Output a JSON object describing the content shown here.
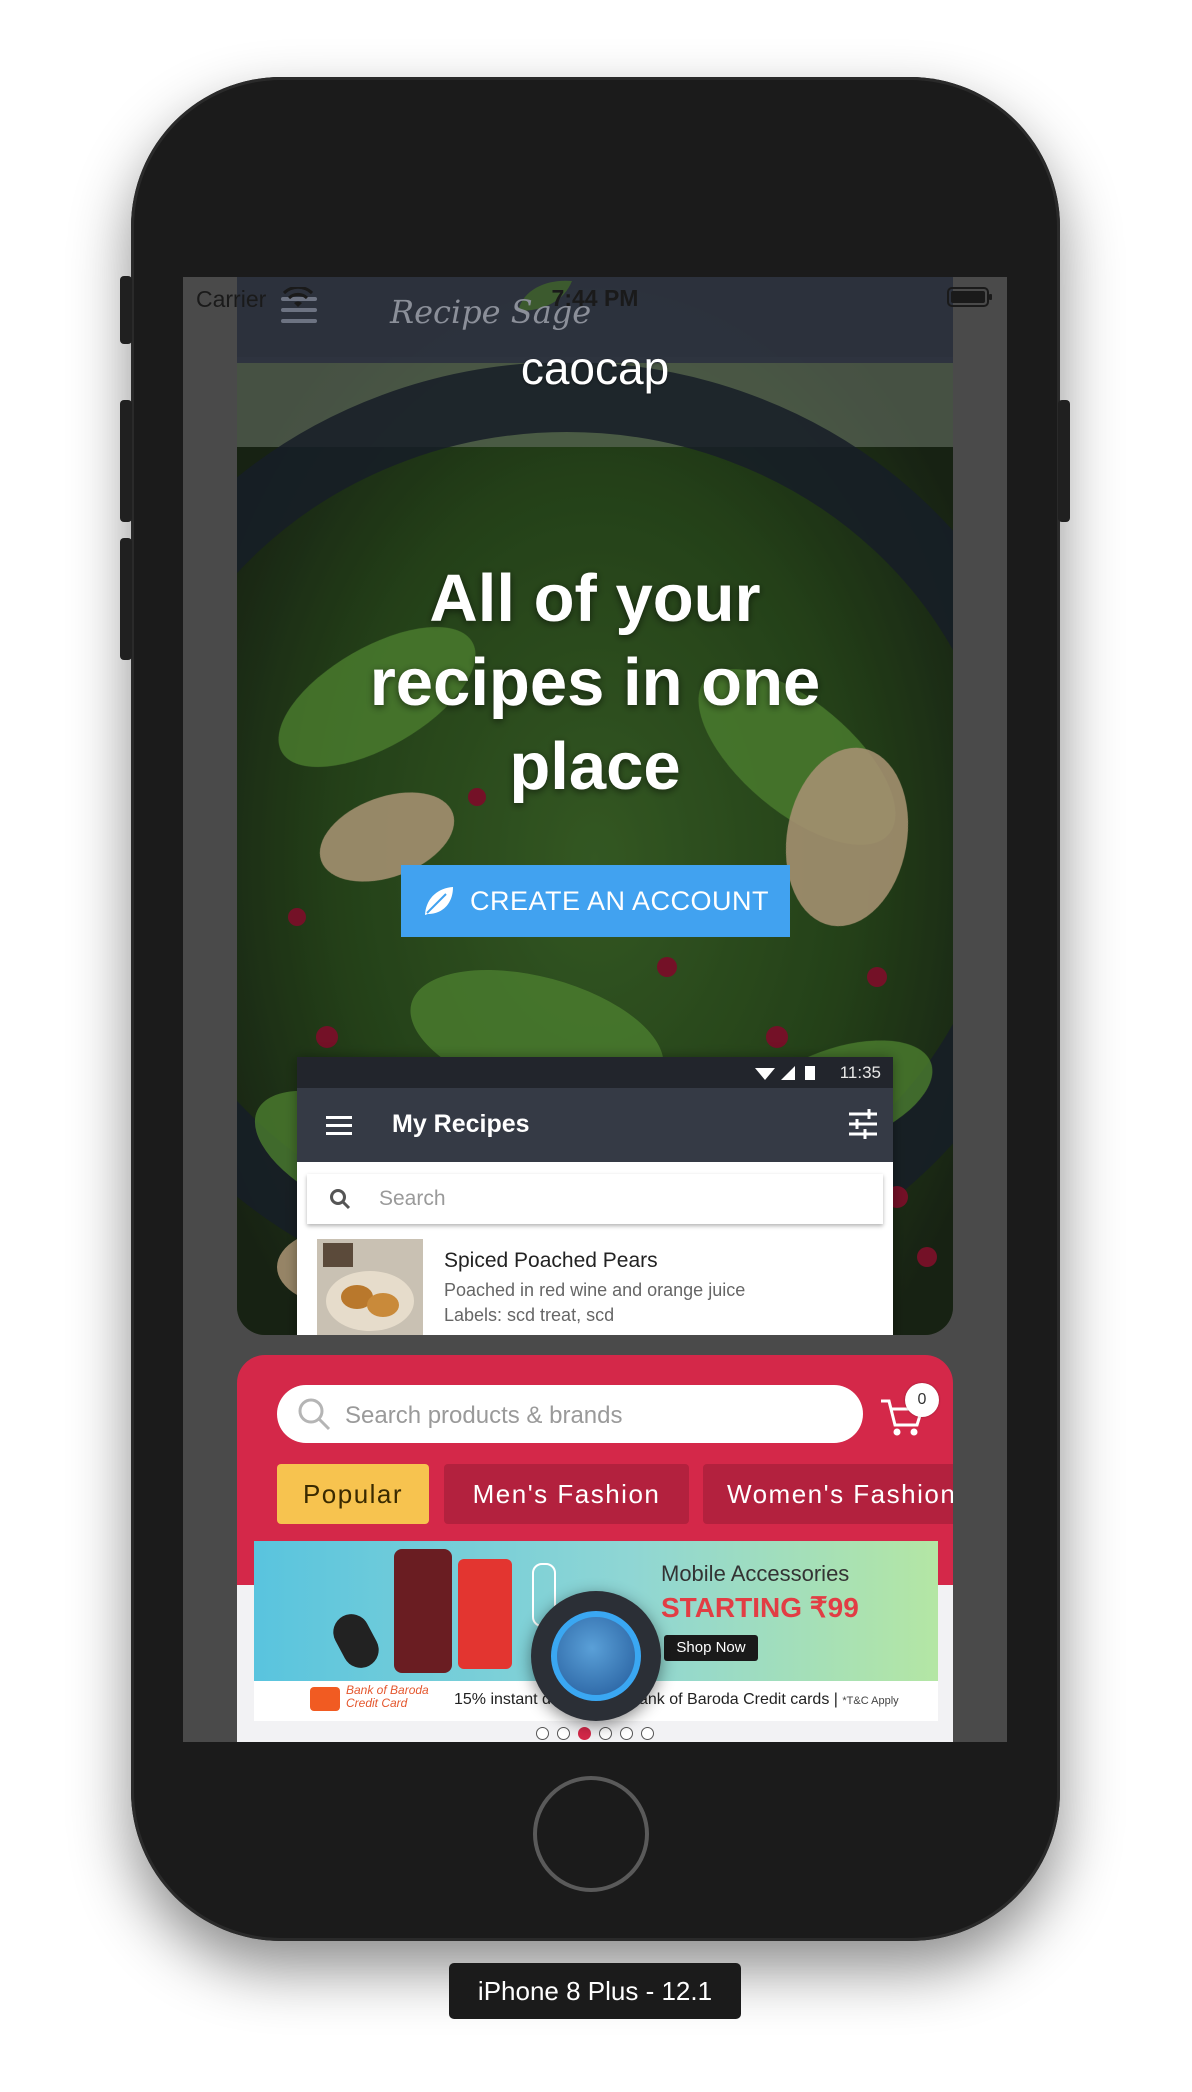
{
  "ios_status": {
    "carrier": "Carrier",
    "time": "7:44 PM"
  },
  "recipe_sage": {
    "logo": "Recipe Sage",
    "overlay_text": "caocap",
    "hero_title": "All of your recipes in one place",
    "cta_label": "CREATE AN ACCOUNT",
    "android": {
      "time": "11:35",
      "toolbar_title": "My Recipes",
      "search_placeholder": "Search",
      "item": {
        "title": "Spiced Poached Pears",
        "description": "Poached in red wine and orange juice",
        "labels": "Labels: scd treat, scd"
      }
    }
  },
  "shop": {
    "search_placeholder": "Search products & brands",
    "cart_count": "0",
    "tabs": [
      "Popular",
      "Men's Fashion",
      "Women's Fashion"
    ],
    "banner": {
      "heading": "Mobile Accessories",
      "price": "STARTING ₹99",
      "button": "Shop Now",
      "bank_name": "Bank of Baroda",
      "bank_sub": "Credit Card",
      "offer": "15% instant discount on Bank of Baroda Credit cards |",
      "tnc": "*T&C Apply"
    },
    "carousel": {
      "count": 6,
      "active_index": 2
    }
  },
  "device_label": "iPhone 8 Plus - 12.1",
  "colors": {
    "cta_blue": "#41a2f0",
    "shop_red": "#d42849",
    "popular_yellow": "#f7c34f",
    "assist_blue": "#3aa7f2"
  },
  "icons": [
    "wifi-icon",
    "battery-icon",
    "hamburger-icon",
    "leaf-icon",
    "tune-icon",
    "search-icon",
    "cart-icon"
  ]
}
